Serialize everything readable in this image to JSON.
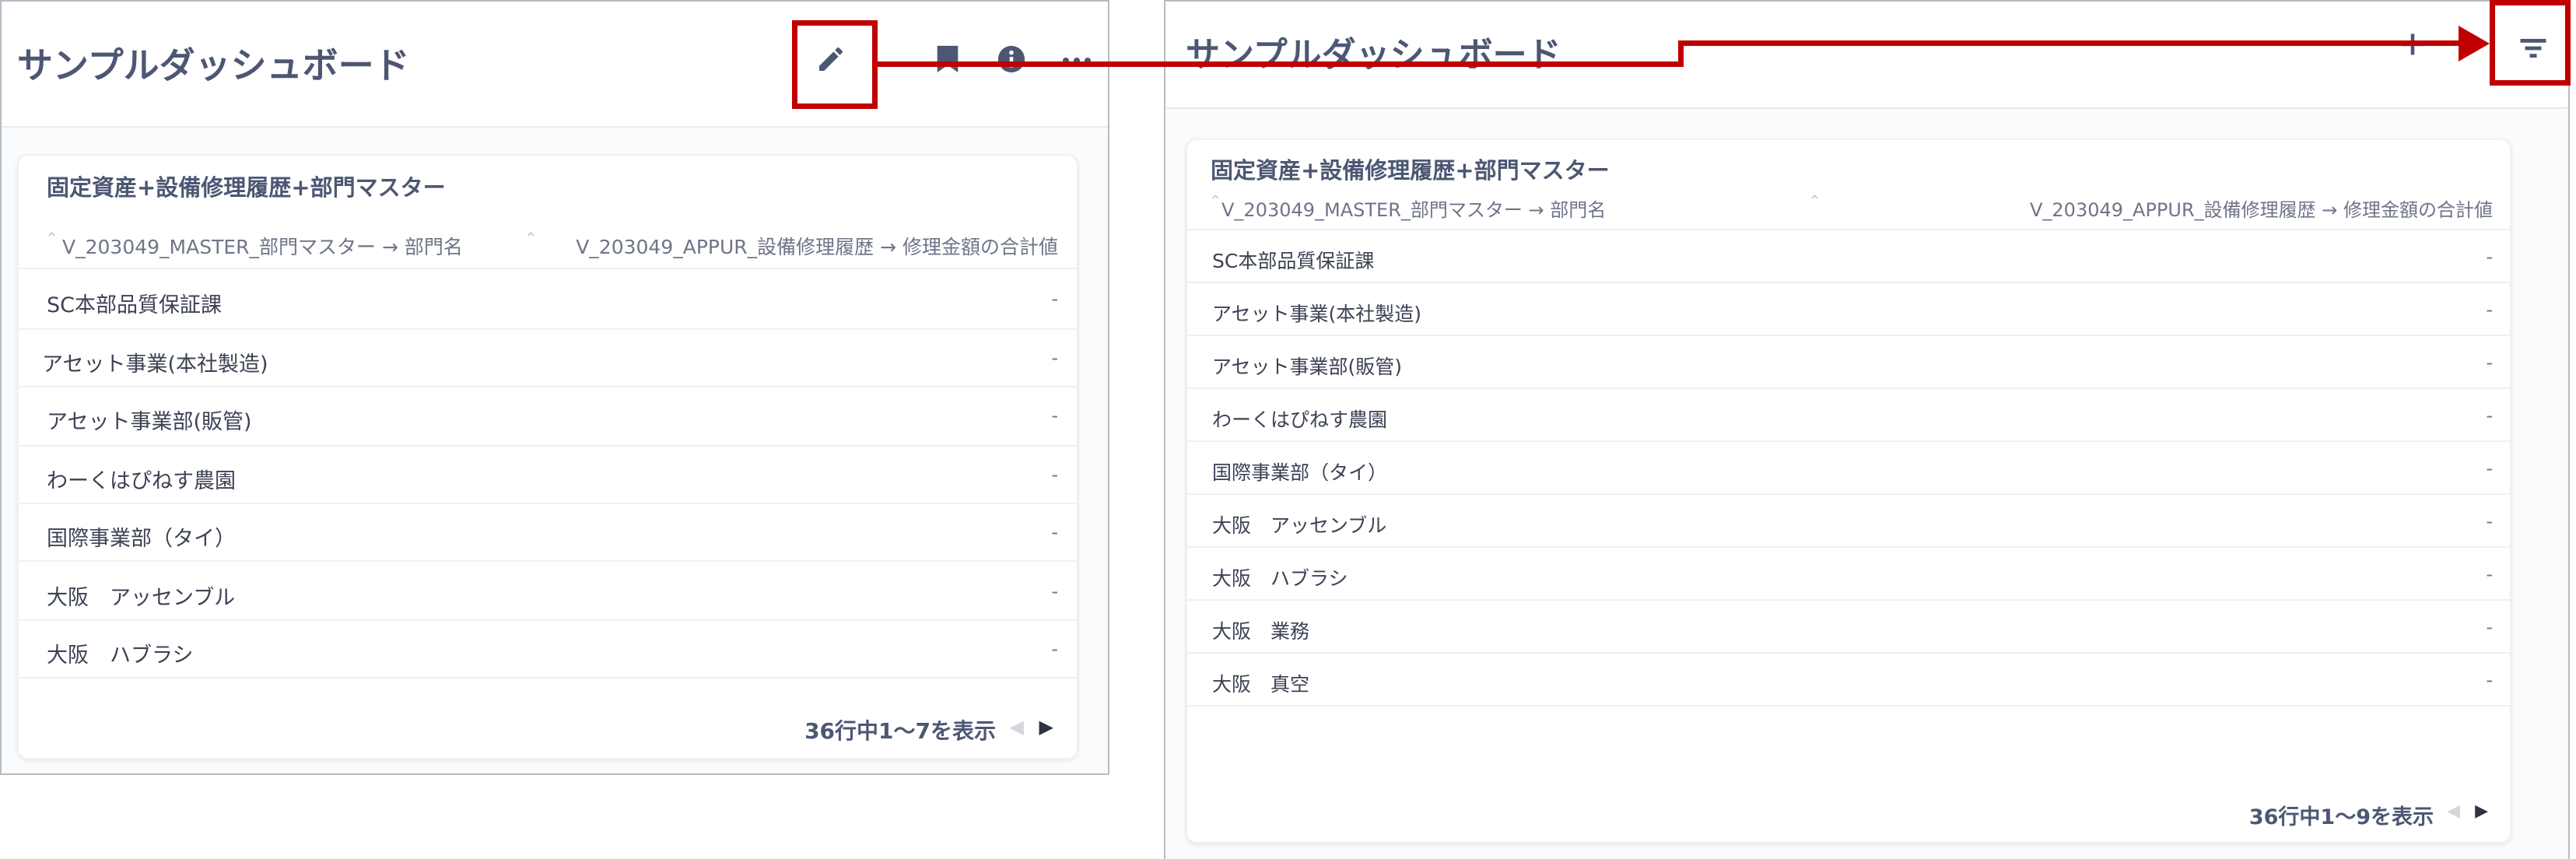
{
  "left": {
    "title": "サンプルダッシュボード",
    "icons": [
      "pencil-icon",
      "bookmark-icon",
      "info-icon",
      "more-icon"
    ],
    "card": {
      "title": "固定資産+設備修理履歴+部門マスター",
      "columns": [
        "V_203049_MASTER_部門マスター → 部門名",
        "V_203049_APPUR_設備修理履歴 → 修理金額の合計値"
      ],
      "rows": [
        {
          "name": "SC本部品質保証課",
          "value": "-"
        },
        {
          "name": "アセット事業(本社製造)",
          "value": "-"
        },
        {
          "name": "アセット事業部(販管)",
          "value": "-"
        },
        {
          "name": "わーくはぴねす農園",
          "value": "-"
        },
        {
          "name": "国際事業部（タイ）",
          "value": "-"
        },
        {
          "name": "大阪　アッセンブル",
          "value": "-"
        },
        {
          "name": "大阪　ハブラシ",
          "value": "-"
        }
      ],
      "footer": "36行中1〜7を表示"
    }
  },
  "right": {
    "title": "サンプルダッシュボード",
    "icons": [
      "plus-icon",
      "filter-icon"
    ],
    "card": {
      "title": "固定資産+設備修理履歴+部門マスター",
      "columns": [
        "V_203049_MASTER_部門マスター → 部門名",
        "V_203049_APPUR_設備修理履歴 → 修理金額の合計値"
      ],
      "rows": [
        {
          "name": "SC本部品質保証課",
          "value": "-"
        },
        {
          "name": "アセット事業(本社製造)",
          "value": "-"
        },
        {
          "name": "アセット事業部(販管)",
          "value": "-"
        },
        {
          "name": "わーくはぴねす農園",
          "value": "-"
        },
        {
          "name": "国際事業部（タイ）",
          "value": "-"
        },
        {
          "name": "大阪　アッセンブル",
          "value": "-"
        },
        {
          "name": "大阪　ハブラシ",
          "value": "-"
        },
        {
          "name": "大阪　業務",
          "value": "-"
        },
        {
          "name": "大阪　真空",
          "value": "-"
        }
      ],
      "footer": "36行中1〜9を表示"
    }
  },
  "colors": {
    "highlight": "#c00000",
    "text": "#4c5773",
    "icon": "#4c5773"
  }
}
